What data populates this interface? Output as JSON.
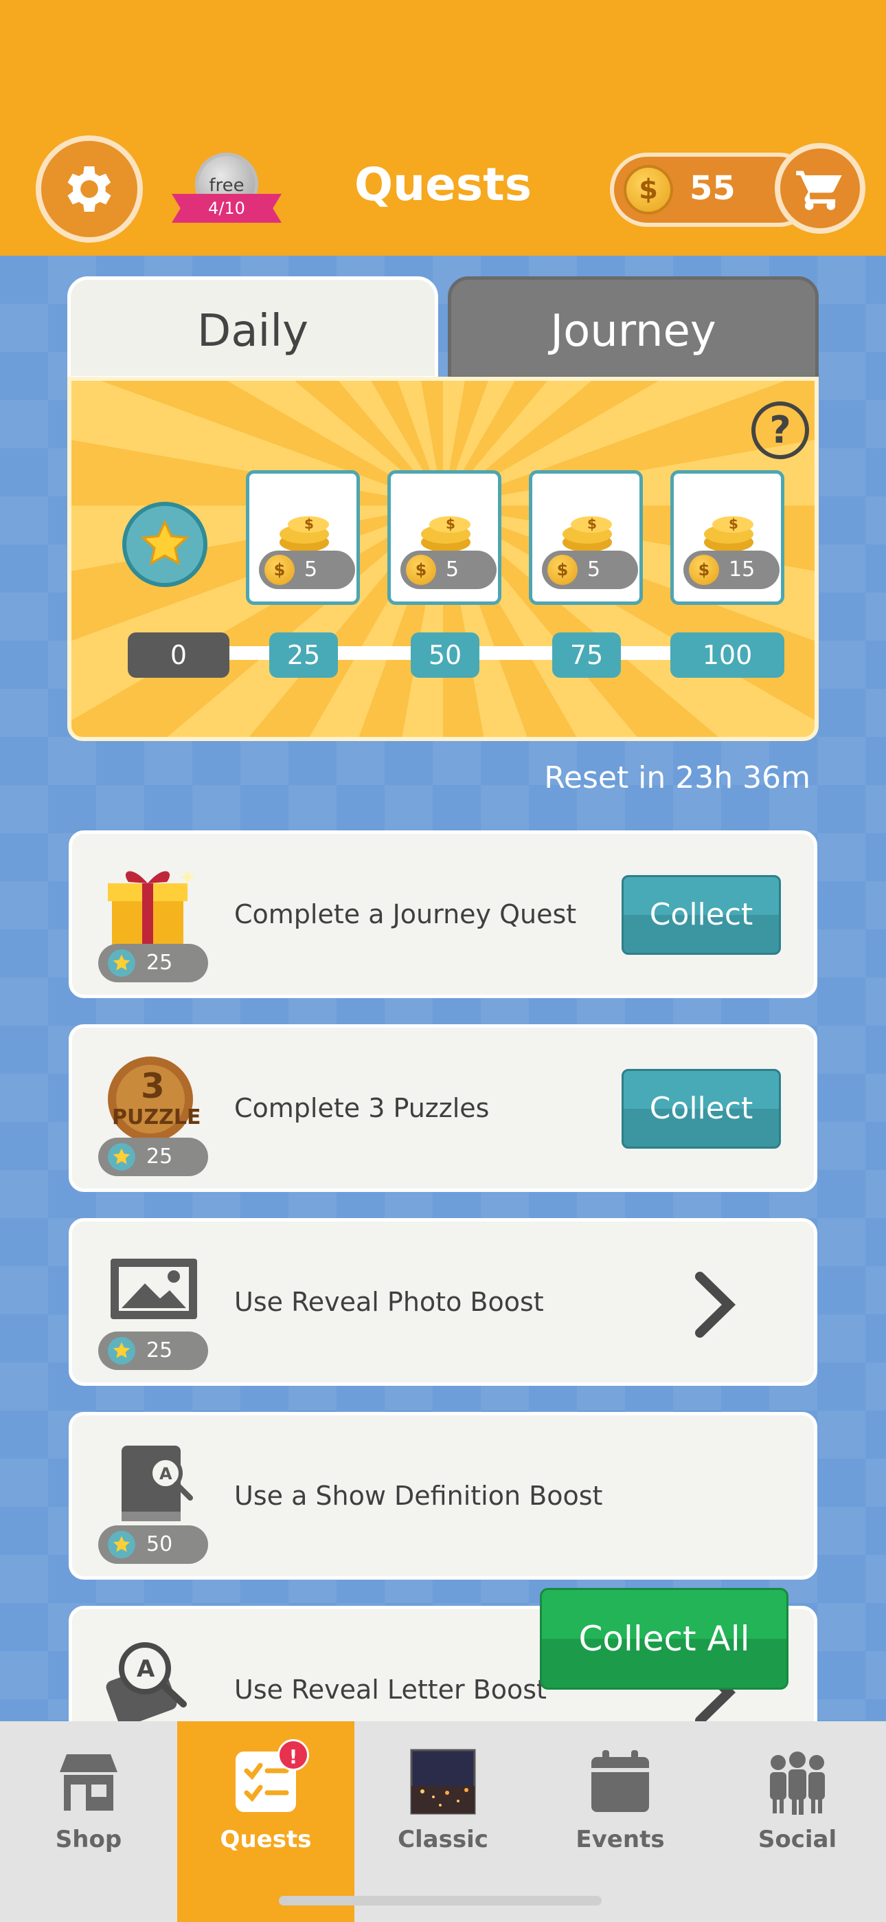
{
  "header": {
    "title": "Quests",
    "free_badge": {
      "label": "free",
      "count": "4/10"
    },
    "coins": "55"
  },
  "tabs": [
    {
      "label": "Daily",
      "active": true
    },
    {
      "label": "Journey",
      "active": false
    }
  ],
  "rewards": {
    "cards": [
      {
        "amount": "5"
      },
      {
        "amount": "5"
      },
      {
        "amount": "5"
      },
      {
        "amount": "15"
      }
    ],
    "milestones": [
      "0",
      "25",
      "50",
      "75",
      "100"
    ]
  },
  "reset_text": "Reset in 23h 36m",
  "quests": [
    {
      "text": "Complete a Journey Quest",
      "points": "25",
      "icon": "gift-icon",
      "action": "Collect"
    },
    {
      "text": "Complete 3 Puzzles",
      "points": "25",
      "icon": "puzzle-medal-icon",
      "action": "Collect"
    },
    {
      "text": "Use Reveal Photo Boost",
      "points": "25",
      "icon": "photo-icon",
      "action": "chevron"
    },
    {
      "text": "Use a Show Definition Boost",
      "points": "50",
      "icon": "definition-book-icon",
      "action": "none"
    },
    {
      "text": "Use Reveal Letter Boost",
      "points": "",
      "icon": "reveal-letter-icon",
      "action": "chevron"
    }
  ],
  "collect_all_label": "Collect All",
  "nav": [
    {
      "label": "Shop",
      "icon": "shop-icon"
    },
    {
      "label": "Quests",
      "icon": "quests-icon",
      "active": true,
      "badge": "!"
    },
    {
      "label": "Classic",
      "icon": "classic-thumbnail"
    },
    {
      "label": "Events",
      "icon": "calendar-icon"
    },
    {
      "label": "Social",
      "icon": "people-icon"
    }
  ],
  "colors": {
    "header": "#f6a81f",
    "accent_teal": "#48aab6",
    "collect_all_green": "#22b456",
    "background_blue": "#6d9ed9"
  }
}
